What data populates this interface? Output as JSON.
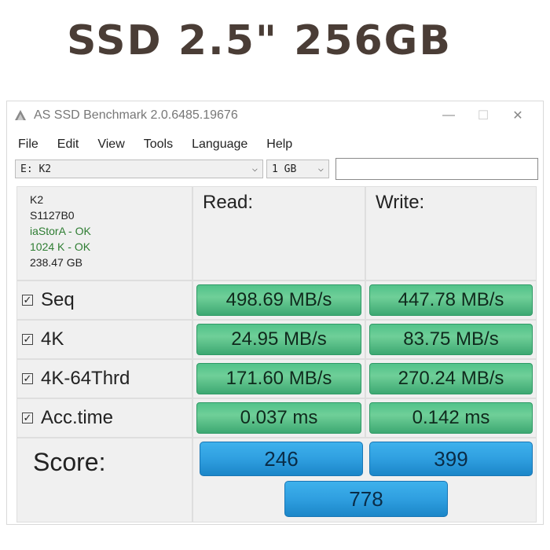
{
  "hero_title": "SSD 2.5\" 256GB",
  "window": {
    "title": "AS SSD Benchmark 2.0.6485.19676",
    "controls": {
      "minimize": "—",
      "maximize": "☐",
      "close": "✕"
    }
  },
  "menu": [
    "File",
    "Edit",
    "View",
    "Tools",
    "Language",
    "Help"
  ],
  "toolbar": {
    "drive_select": "E: K2",
    "size_select": "1 GB",
    "name_field": ""
  },
  "drive_info": {
    "name": "K2",
    "firmware": "S1127B0",
    "driver_status": "iaStorA - OK",
    "alignment_status": "1024 K - OK",
    "capacity": "238.47 GB"
  },
  "headers": {
    "read": "Read:",
    "write": "Write:"
  },
  "rows": [
    {
      "label": "Seq",
      "read": "498.69 MB/s",
      "write": "447.78 MB/s"
    },
    {
      "label": "4K",
      "read": "24.95 MB/s",
      "write": "83.75 MB/s"
    },
    {
      "label": "4K-64Thrd",
      "read": "171.60 MB/s",
      "write": "270.24 MB/s"
    },
    {
      "label": "Acc.time",
      "read": "0.037 ms",
      "write": "0.142 ms"
    }
  ],
  "score": {
    "label": "Score:",
    "read": "246",
    "write": "399",
    "total": "778"
  },
  "colors": {
    "ok_green": "#2e7d32",
    "bar_green": "#52c28a",
    "bar_blue": "#2f9fe0",
    "title_brown": "#4a3d36"
  }
}
